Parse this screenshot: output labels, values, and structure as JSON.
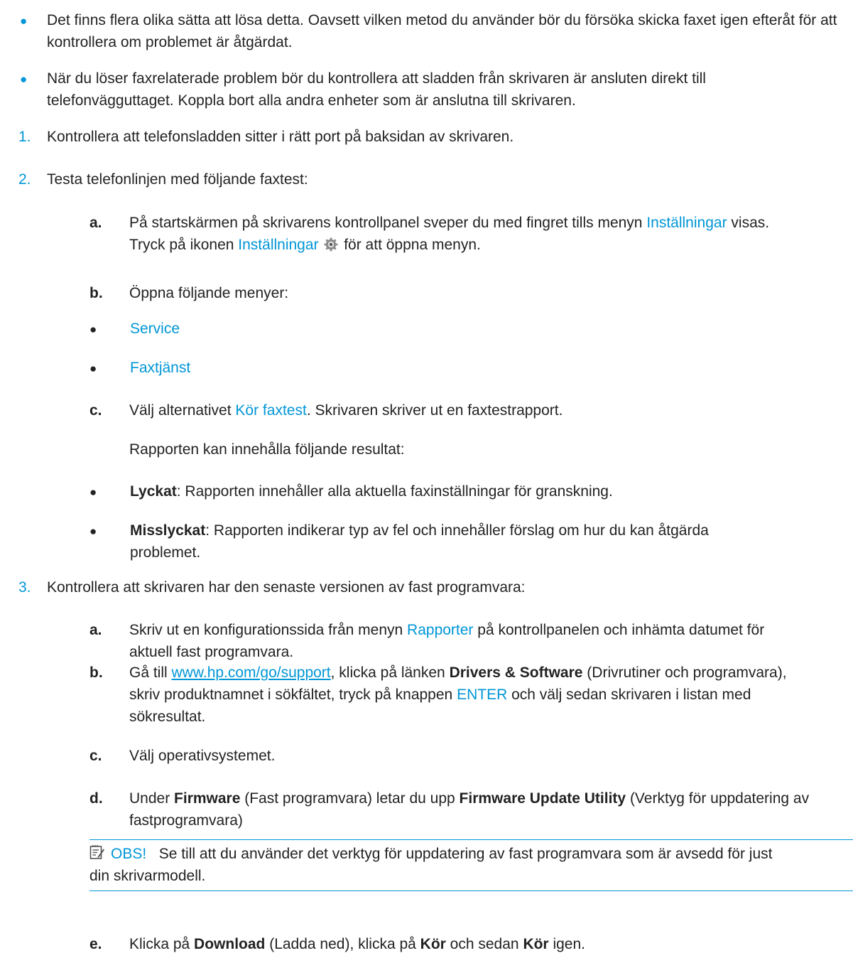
{
  "intro": [
    "Det finns flera olika sätta att lösa detta. Oavsett vilken metod du använder bör du försöka skicka faxet igen efteråt för att kontrollera om problemet är åtgärdat.",
    "När du löser faxrelaterade problem bör du kontrollera att sladden från skrivaren är ansluten direkt till telefonvägguttaget. Koppla bort alla andra enheter som är anslutna till skrivaren."
  ],
  "steps": {
    "s1": {
      "num": "1.",
      "text": "Kontrollera att telefonsladden sitter i rätt port på baksidan av skrivaren."
    },
    "s2": {
      "num": "2.",
      "text": "Testa telefonlinjen med följande faxtest:"
    },
    "s2a": {
      "letter": "a.",
      "p1": "På startskärmen på skrivarens kontrollpanel sveper du med fingret tills menyn ",
      "link1": "Inställningar",
      "p2": " visas.",
      "p3": "Tryck på ikonen ",
      "link2": "Inställningar",
      "p4": " för att öppna menyn."
    },
    "s2b": {
      "letter": "b.",
      "text": "Öppna följande menyer:",
      "items": [
        "Service",
        "Faxtjänst"
      ]
    },
    "s2c": {
      "letter": "c.",
      "p1": "Välj alternativet ",
      "link": "Kör faxtest",
      "p2": ". Skrivaren skriver ut en faxtestrapport.",
      "results_intro": "Rapporten kan innehålla följande resultat:",
      "r1_label": "Lyckat",
      "r1_text": ": Rapporten innehåller alla aktuella faxinställningar för granskning.",
      "r2_label": "Misslyckat",
      "r2_text1": ": Rapporten indikerar typ av fel och innehåller förslag om hur du kan åtgärda",
      "r2_text2": "problemet."
    },
    "s3": {
      "num": "3.",
      "text": "Kontrollera att skrivaren har den senaste versionen av fast programvara:"
    },
    "s3a": {
      "letter": "a.",
      "p1": "Skriv ut en konfigurationssida från menyn ",
      "link": "Rapporter",
      "p2": " på kontrollpanelen och inhämta datumet för",
      "p3": "aktuell fast programvara."
    },
    "s3b": {
      "letter": "b.",
      "p1": "Gå till ",
      "url": "www.hp.com/go/support",
      "p2": ", klicka på länken ",
      "b1": "Drivers & Software",
      "p3": " (Drivrutiner och programvara),",
      "p4": "skriv produktnamnet i sökfältet, tryck på knappen ",
      "link": "ENTER",
      "p5": " och välj sedan skrivaren i listan med",
      "p6": "sökresultat."
    },
    "s3c": {
      "letter": "c.",
      "text": "Välj operativsystemet."
    },
    "s3d": {
      "letter": "d.",
      "p1": "Under ",
      "b1": "Firmware",
      "p2": " (Fast programvara) letar du upp ",
      "b2": "Firmware Update Utility",
      "p3": " (Verktyg för uppdatering av",
      "p4": "fastprogramvara)"
    },
    "note": {
      "label": "OBS!",
      "text1": "Se till att du använder det verktyg för uppdatering av fast programvara som är avsedd för just",
      "text2": "din skrivarmodell."
    },
    "s3e": {
      "letter": "e.",
      "p1": "Klicka på ",
      "b1": "Download",
      "p2": " (Ladda ned), klicka på ",
      "b2": "Kör",
      "p3": " och sedan ",
      "b3": "Kör",
      "p4": " igen."
    }
  },
  "colors": {
    "accent": "#0096d6",
    "text": "#222222"
  },
  "icons": [
    "settings-gear-icon",
    "note-icon"
  ]
}
